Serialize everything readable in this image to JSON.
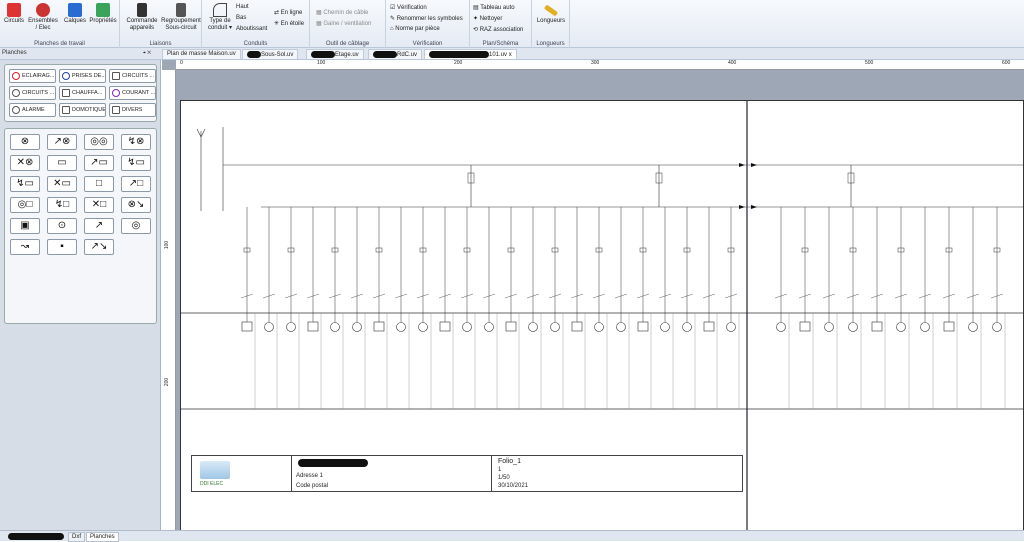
{
  "ribbon": {
    "groups": [
      {
        "label": "Planches de travail"
      },
      {
        "label": "Liaisons"
      },
      {
        "label": "Conduits"
      },
      {
        "label": "Outil de câblage"
      },
      {
        "label": "Vérification"
      },
      {
        "label": "Plan/Schéma"
      },
      {
        "label": "Longueurs"
      }
    ],
    "buttons": {
      "circuits": "Circuits",
      "ensembles_l1": "Ensembles",
      "ensembles_l2": "/ Elec",
      "calques": "Calques",
      "proprietes": "Propriétés",
      "commande_l1": "Commande",
      "commande_l2": "appareils",
      "regroupement_l1": "Regroupement",
      "regroupement_l2": "Sous-circuit",
      "type_conduit_l1": "Type de",
      "type_conduit_l2": "conduit",
      "haut": "Haut",
      "bas": "Bas",
      "aboutissant": "Aboutissant",
      "en_ligne": "En ligne",
      "en_etoile": "En étoile",
      "chemin_cable": "Chemin de câble",
      "gaine_ventilation": "Gaine / ventilation",
      "verification": "Vérification",
      "renommer_symboles": "Renommer les symboles",
      "norme_piece": "Norme par pièce",
      "tableau_auto": "Tableau auto",
      "nettoyer": "Nettoyer",
      "raz_association": "RAZ association",
      "longueurs": "Longueurs"
    }
  },
  "panel": {
    "title": "Planches",
    "pin": "⌖ ✕"
  },
  "tabs": [
    {
      "label": "Plan de masse Maison.uv"
    },
    {
      "label": "Sous-Sol.uv"
    },
    {
      "label": "Etage.uv"
    },
    {
      "label": "RdC.uv"
    },
    {
      "label": "101.uv"
    }
  ],
  "tab_close": "x",
  "categories": [
    {
      "label": "ECLAIRAG..."
    },
    {
      "label": "PRISES DE..."
    },
    {
      "label": "CIRCUITS ..."
    },
    {
      "label": "CIRCUITS ..."
    },
    {
      "label": "CHAUFFA..."
    },
    {
      "label": "COURANT ..."
    },
    {
      "label": "ALARME"
    },
    {
      "label": "DOMOTIQUE"
    },
    {
      "label": "DIVERS"
    }
  ],
  "symbols": [
    "⊗",
    "↗⊗",
    "◎◎",
    "↯⊗",
    "✕⊗",
    "▭",
    "↗▭",
    "↯▭",
    "↯▭",
    "✕▭",
    "□",
    "↗□",
    "◎□",
    "↯□",
    "✕□",
    "⊗↘",
    "▣",
    "⊙",
    "↗",
    "◎",
    "↝",
    "▪",
    "↗↘"
  ],
  "ruler_h": [
    "0",
    "100",
    "200",
    "300",
    "400",
    "500",
    "600"
  ],
  "ruler_v": [
    "100",
    "200"
  ],
  "titleblock": {
    "logo_text": "DDI ELEC",
    "address": "Adresse 1",
    "postal": "Code postal",
    "folio": "Folio_1",
    "folio_num": "1",
    "scale": "1/50",
    "date": "30/10/2021"
  },
  "bottom_tabs": [
    {
      "label": "Dxf"
    },
    {
      "label": "Planches"
    }
  ]
}
